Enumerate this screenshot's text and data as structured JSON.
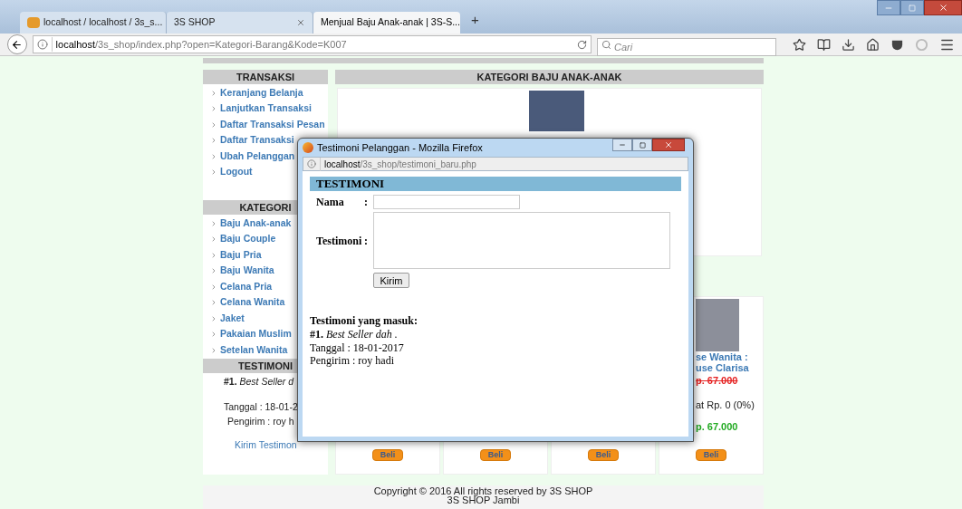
{
  "browser": {
    "tabs": [
      {
        "title": "localhost / localhost / 3s_s...",
        "selected": false
      },
      {
        "title": "3S SHOP",
        "selected": false
      },
      {
        "title": "Menjual Baju Anak-anak | 3S-S...",
        "selected": true
      }
    ],
    "new_tab": "+",
    "url_host": "localhost",
    "url_path": "/3s_shop/index.php?open=Kategori-Barang&Kode=K007",
    "search_placeholder": "Cari"
  },
  "sidebar": {
    "sections": [
      {
        "title": "TRANSAKSI",
        "kind": "links",
        "items": [
          "Keranjang Belanja",
          "Lanjutkan Transaksi",
          "Daftar Transaksi Pesan",
          "Daftar Transaksi",
          "Ubah Pelanggan",
          "Logout"
        ]
      },
      {
        "title": "KATEGORI",
        "kind": "links",
        "items": [
          "Baju Anak-anak",
          "Baju Couple",
          "Baju Pria",
          "Baju Wanita",
          "Celana Pria",
          "Celana Wanita",
          "Jaket",
          "Pakaian Muslim",
          "Setelan Wanita"
        ]
      },
      {
        "title": "TESTIMONI",
        "kind": "testimonials",
        "entry": "**#1.** *Best Seller d*",
        "date": "Tanggal : 18-01-2",
        "sender": "Pengirim : roy h",
        "link": "Kirim Testimon"
      }
    ]
  },
  "main": {
    "title": "KATEGORI BAJU ANAK-ANAK",
    "products": [
      {
        "buy": "Beli"
      },
      {
        "buy": "Beli"
      },
      {
        "buy": "Beli"
      },
      {
        "name_lines": [
          "se Wanita :",
          "use Clarisa"
        ],
        "old_price": "p. 67.000",
        "discount": "at Rp. 0 (0%)",
        "price": "p. 67.000",
        "buy": "Beli"
      }
    ]
  },
  "footer": {
    "lines": [
      "Copyright © 2016 All rights reserved by 3S SHOP",
      "3S SHOP Jambi"
    ]
  },
  "popup": {
    "title": "Testimoni Pelanggan - Mozilla Firefox",
    "url_host": "localhost",
    "url_path": "/3s_shop/testimoni_baru.php",
    "heading": "TESTIMONI",
    "fields": [
      {
        "label": "Nama",
        "colon": ":",
        "kind": "text"
      },
      {
        "label": "Testimoni",
        "colon": ":",
        "kind": "textarea"
      }
    ],
    "submit": "Kirim",
    "list_title": "Testimoni yang masuk:",
    "entries": [
      {
        "text": "**#1.** *Best Seller dah .*",
        "date": "Tanggal : 18-01-2017",
        "sender": "Pengirim : roy hadi"
      }
    ]
  }
}
